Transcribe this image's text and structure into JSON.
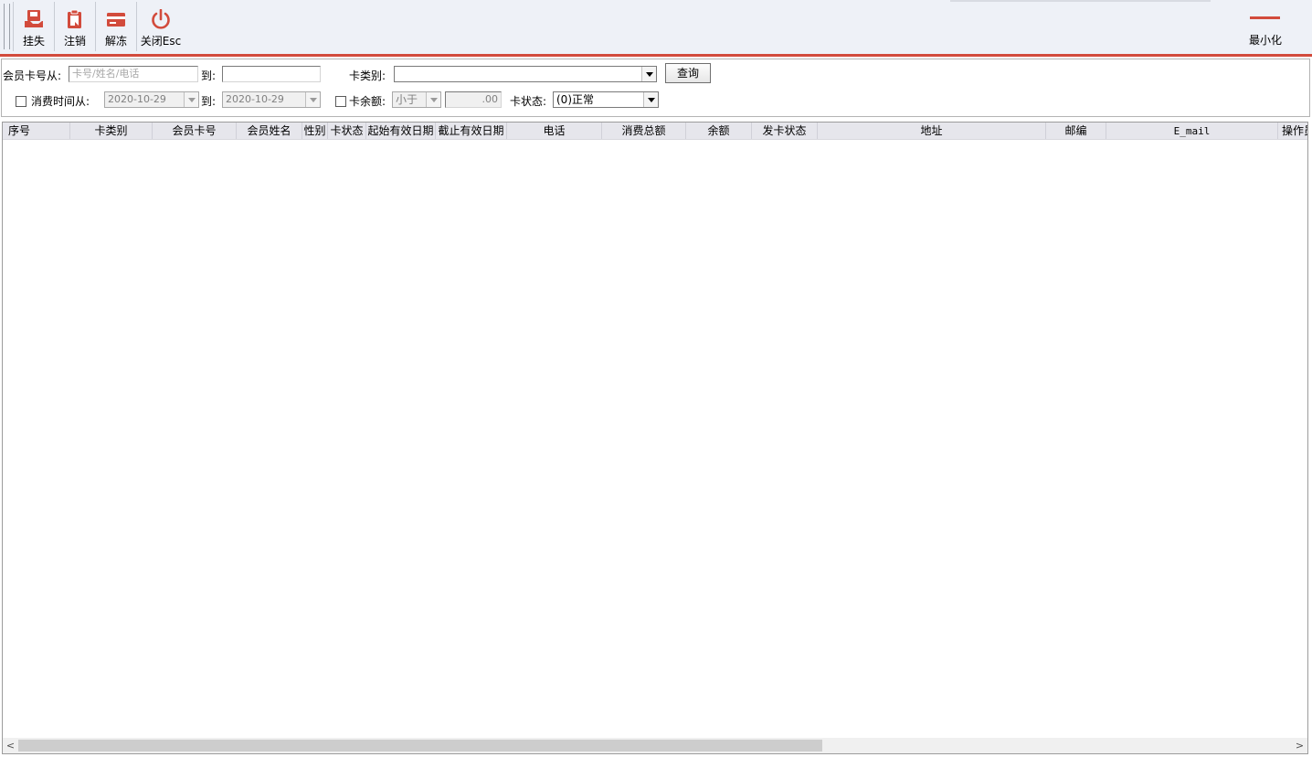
{
  "toolbar": {
    "buttons": [
      {
        "label": "挂失",
        "icon": "report-loss-icon"
      },
      {
        "label": "注销",
        "icon": "clipboard-icon"
      },
      {
        "label": "解冻",
        "icon": "card-icon"
      },
      {
        "label": "关闭Esc",
        "icon": "power-icon"
      }
    ],
    "minimize_label": "最小化",
    "accent_color": "#d24b3c"
  },
  "filters": {
    "card_from_label": "会员卡号从:",
    "card_from_placeholder": "卡号/姓名/电话",
    "card_to_label": "到:",
    "card_to_value": "",
    "card_type_label": "卡类别:",
    "card_type_value": "",
    "query_button": "查询",
    "consume_time_label": "消费时间从:",
    "consume_time_checked": false,
    "date_from": "2020-10-29",
    "date_to_label": "到:",
    "date_to": "2020-10-29",
    "balance_label": "卡余额:",
    "balance_checked": false,
    "balance_op": "小于",
    "balance_value": ".00",
    "card_status_label": "卡状态:",
    "card_status_value": "(0)正常"
  },
  "grid": {
    "columns": [
      "序号",
      "卡类别",
      "会员卡号",
      "会员姓名",
      "性别",
      "卡状态",
      "起始有效日期",
      "截止有效日期",
      "电话",
      "消费总额",
      "余额",
      "发卡状态",
      "地址",
      "邮编",
      "E_mail",
      "操作员"
    ],
    "rows": []
  },
  "scrollbar": {
    "left_arrow": "<",
    "right_arrow": ">"
  }
}
